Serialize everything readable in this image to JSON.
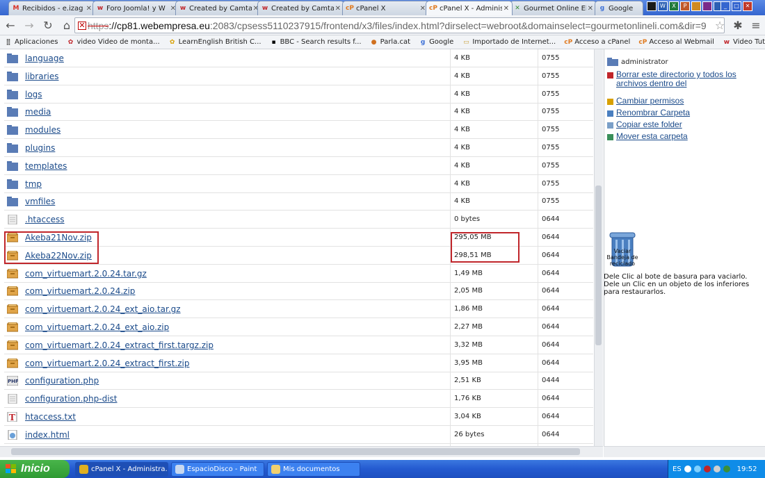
{
  "tabs": [
    {
      "title": "Recibidos - e.izag",
      "icon": "gmail-icon",
      "color": "#d93025",
      "glyph": "M"
    },
    {
      "title": "Foro Joomla! y W",
      "icon": "webempresa-icon",
      "color": "#c0252a",
      "glyph": "w"
    },
    {
      "title": "Created by Camta",
      "icon": "webempresa-icon",
      "color": "#c0252a",
      "glyph": "w"
    },
    {
      "title": "Created by Camta",
      "icon": "webempresa-icon",
      "color": "#c0252a",
      "glyph": "w"
    },
    {
      "title": "cPanel X",
      "icon": "cpanel-icon",
      "color": "#e07a1f",
      "glyph": "cP"
    },
    {
      "title": "cPanel X - Adminis",
      "icon": "cpanel-icon",
      "color": "#e07a1f",
      "glyph": "cP",
      "active": true
    },
    {
      "title": "Gourmet Online El",
      "icon": "joomla-icon",
      "color": "#3a8f3a",
      "glyph": "✕"
    },
    {
      "title": "Google",
      "icon": "google-icon",
      "color": "#3b6fd6",
      "glyph": "g"
    }
  ],
  "address": {
    "scheme": "https",
    "host": "://cp81.webempresa.eu",
    "path": ":2083/cpsess5110237915/frontend/x3/files/index.html?dirselect=webroot&domainselect=gourmetonlineli.com&dir=9"
  },
  "bookmarks": [
    {
      "label": "Aplicaciones",
      "icon": "apps-icon",
      "color": "#555",
      "glyph": "⣿"
    },
    {
      "label": "video Video de monta...",
      "icon": "bookmark-icon",
      "color": "#c0252a",
      "glyph": "✿"
    },
    {
      "label": "LearnEnglish  British C...",
      "icon": "bookmark-icon",
      "color": "#d8a000",
      "glyph": "✿"
    },
    {
      "label": "BBC - Search results f...",
      "icon": "bbc-icon",
      "color": "#000",
      "glyph": "▪"
    },
    {
      "label": "Parla.cat",
      "icon": "bookmark-icon",
      "color": "#d07020",
      "glyph": "●"
    },
    {
      "label": "Google",
      "icon": "google-icon",
      "color": "#3b6fd6",
      "glyph": "g"
    },
    {
      "label": "Importado de Internet...",
      "icon": "folder-icon",
      "color": "#c9a03a",
      "glyph": "▭"
    },
    {
      "label": "Acceso a cPanel",
      "icon": "cpanel-icon",
      "color": "#e07a1f",
      "glyph": "cP"
    },
    {
      "label": "Acceso al Webmail",
      "icon": "cpanel-icon",
      "color": "#e07a1f",
      "glyph": "cP"
    },
    {
      "label": "Video Tutoriales Pack ...",
      "icon": "bookmark-icon",
      "color": "#c0252a",
      "glyph": "w"
    }
  ],
  "files": [
    {
      "name": "language",
      "size": "4 KB",
      "perm": "0755",
      "type": "folder"
    },
    {
      "name": "libraries",
      "size": "4 KB",
      "perm": "0755",
      "type": "folder"
    },
    {
      "name": "logs",
      "size": "4 KB",
      "perm": "0755",
      "type": "folder"
    },
    {
      "name": "media",
      "size": "4 KB",
      "perm": "0755",
      "type": "folder"
    },
    {
      "name": "modules",
      "size": "4 KB",
      "perm": "0755",
      "type": "folder"
    },
    {
      "name": "plugins",
      "size": "4 KB",
      "perm": "0755",
      "type": "folder"
    },
    {
      "name": "templates",
      "size": "4 KB",
      "perm": "0755",
      "type": "folder"
    },
    {
      "name": "tmp",
      "size": "4 KB",
      "perm": "0755",
      "type": "folder"
    },
    {
      "name": "vmfiles",
      "size": "4 KB",
      "perm": "0755",
      "type": "folder"
    },
    {
      "name": ".htaccess",
      "size": "0 bytes",
      "perm": "0644",
      "type": "doc"
    },
    {
      "name": "Akeba21Nov.zip",
      "size": "295,05 MB",
      "perm": "0644",
      "type": "zip"
    },
    {
      "name": "Akeba22Nov.zip",
      "size": "298,51 MB",
      "perm": "0644",
      "type": "zip"
    },
    {
      "name": "com_virtuemart.2.0.24.tar.gz",
      "size": "1,49 MB",
      "perm": "0644",
      "type": "zip"
    },
    {
      "name": "com_virtuemart.2.0.24.zip",
      "size": "2,05 MB",
      "perm": "0644",
      "type": "zip"
    },
    {
      "name": "com_virtuemart.2.0.24_ext_aio.tar.gz",
      "size": "1,86 MB",
      "perm": "0644",
      "type": "zip"
    },
    {
      "name": "com_virtuemart.2.0.24_ext_aio.zip",
      "size": "2,27 MB",
      "perm": "0644",
      "type": "zip"
    },
    {
      "name": "com_virtuemart.2.0.24_extract_first.targz.zip",
      "size": "3,32 MB",
      "perm": "0644",
      "type": "zip"
    },
    {
      "name": "com_virtuemart.2.0.24_extract_first.zip",
      "size": "3,95 MB",
      "perm": "0644",
      "type": "zip"
    },
    {
      "name": "configuration.php",
      "size": "2,51 KB",
      "perm": "0444",
      "type": "php"
    },
    {
      "name": "configuration.php-dist",
      "size": "1,76 KB",
      "perm": "0644",
      "type": "doc"
    },
    {
      "name": "htaccess.txt",
      "size": "3,04 KB",
      "perm": "0644",
      "type": "txt"
    },
    {
      "name": "index.html",
      "size": "26 bytes",
      "perm": "0644",
      "type": "html"
    }
  ],
  "panel": {
    "directory": "administrator",
    "actions": [
      {
        "label": "Borrar este directorio y todos los archivos dentro del",
        "icon": "delete-icon",
        "color": "#c0252a"
      },
      {
        "label": "Cambiar permisos",
        "icon": "key-icon",
        "color": "#d8a000"
      },
      {
        "label": "Renombrar Carpeta",
        "icon": "rename-icon",
        "color": "#4a7fc0"
      },
      {
        "label": "Copiar este folder",
        "icon": "copy-icon",
        "color": "#7a9fc8"
      },
      {
        "label": "Mover esta carpeta",
        "icon": "move-icon",
        "color": "#3a8f5a"
      }
    ],
    "trash_label": "Vaciar Bandeja de reciclado",
    "trash_hint": "Dele Clic al bote de basura para vaciarlo. Dele un Clic en un objeto de los inferiores para restaurarlos."
  },
  "taskbar": {
    "start": "Inicio",
    "items": [
      {
        "label": "cPanel X - Administra...",
        "icon": "chrome-icon",
        "active": true
      },
      {
        "label": "EspacioDisco - Paint",
        "icon": "paint-icon"
      },
      {
        "label": "Mis documentos",
        "icon": "folder-icon"
      }
    ],
    "lang": "ES",
    "time": "19:52"
  }
}
